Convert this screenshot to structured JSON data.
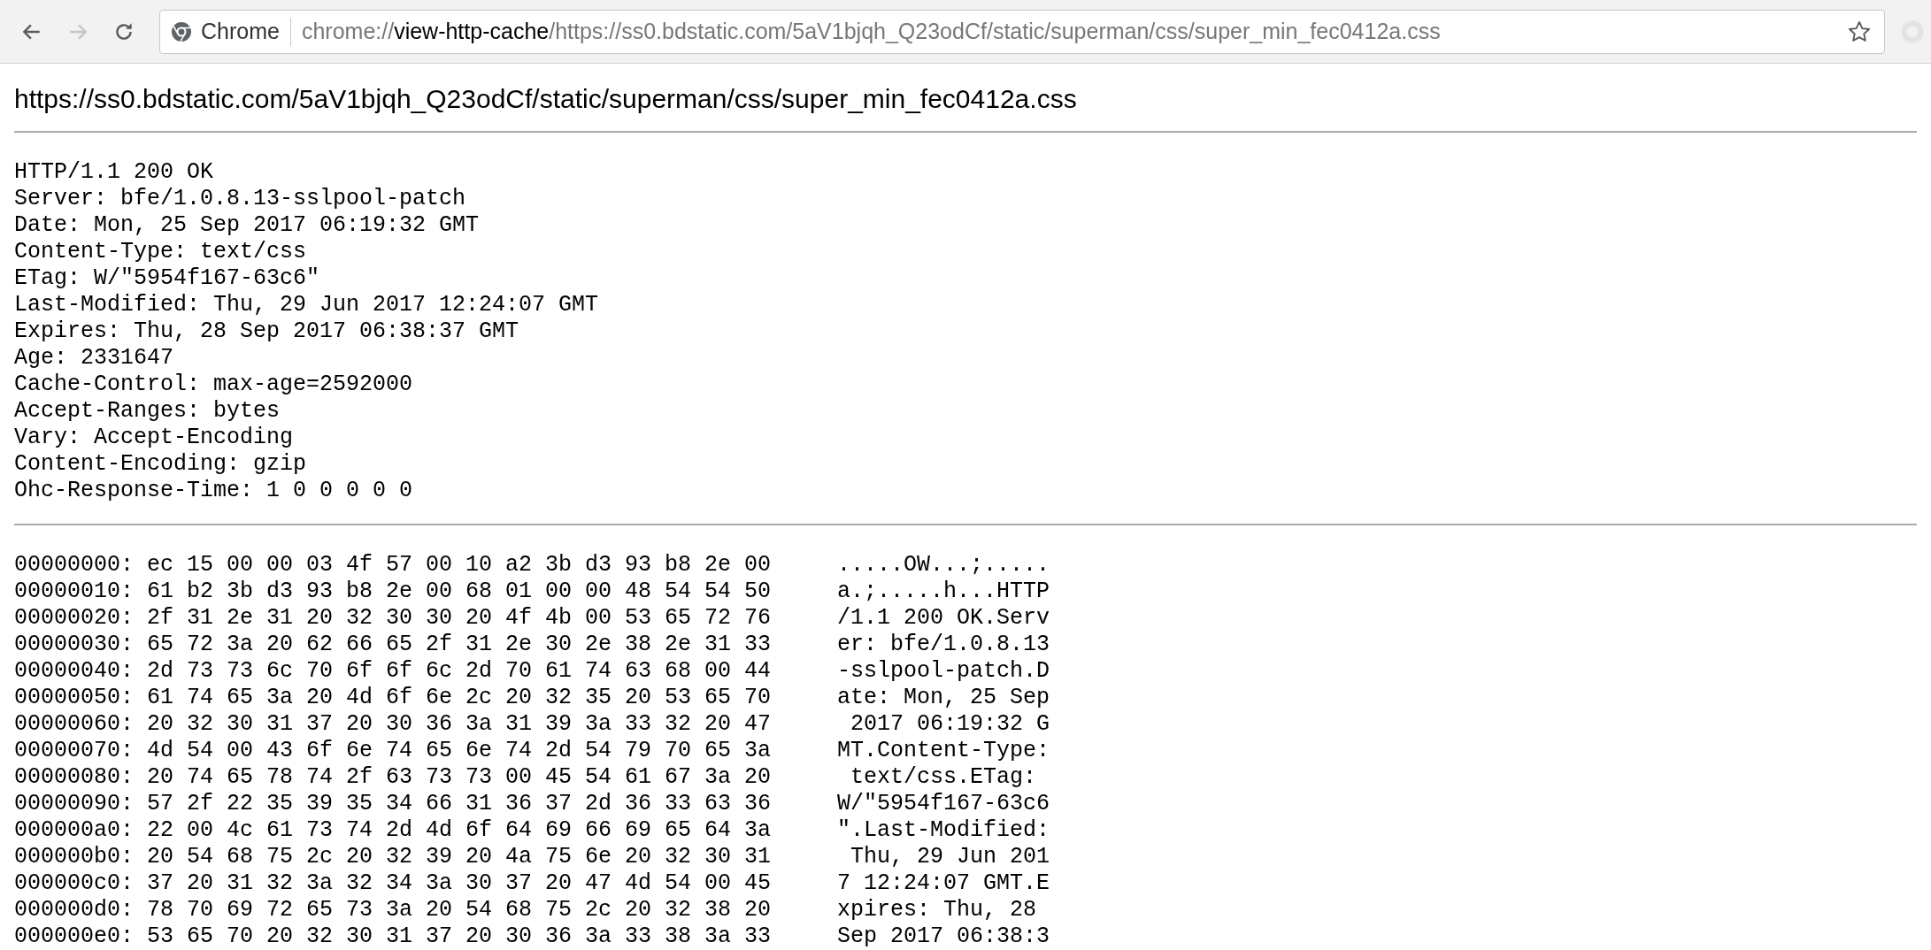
{
  "toolbar": {
    "back": {
      "disabled": false
    },
    "forward": {
      "disabled": true
    },
    "chip": "Chrome",
    "address": {
      "scheme": "chrome://",
      "host": "view-http-cache",
      "rest": "/https://ss0.bdstatic.com/5aV1bjqh_Q23odCf/static/superman/css/super_min_fec0412a.css"
    },
    "bookmarked": false
  },
  "page": {
    "heading": "https://ss0.bdstatic.com/5aV1bjqh_Q23odCf/static/superman/css/super_min_fec0412a.css",
    "headers": [
      "HTTP/1.1 200 OK",
      "Server: bfe/1.0.8.13-sslpool-patch",
      "Date: Mon, 25 Sep 2017 06:19:32 GMT",
      "Content-Type: text/css",
      "ETag: W/\"5954f167-63c6\"",
      "Last-Modified: Thu, 29 Jun 2017 12:24:07 GMT",
      "Expires: Thu, 28 Sep 2017 06:38:37 GMT",
      "Age: 2331647",
      "Cache-Control: max-age=2592000",
      "Accept-Ranges: bytes",
      "Vary: Accept-Encoding",
      "Content-Encoding: gzip",
      "Ohc-Response-Time: 1 0 0 0 0 0"
    ],
    "hex_rows": [
      {
        "offset": "00000000:",
        "hex": "ec 15 00 00 03 4f 57 00 10 a2 3b d3 93 b8 2e 00",
        "ascii": ".....OW...;....."
      },
      {
        "offset": "00000010:",
        "hex": "61 b2 3b d3 93 b8 2e 00 68 01 00 00 48 54 54 50",
        "ascii": "a.;.....h...HTTP"
      },
      {
        "offset": "00000020:",
        "hex": "2f 31 2e 31 20 32 30 30 20 4f 4b 00 53 65 72 76",
        "ascii": "/1.1 200 OK.Serv"
      },
      {
        "offset": "00000030:",
        "hex": "65 72 3a 20 62 66 65 2f 31 2e 30 2e 38 2e 31 33",
        "ascii": "er: bfe/1.0.8.13"
      },
      {
        "offset": "00000040:",
        "hex": "2d 73 73 6c 70 6f 6f 6c 2d 70 61 74 63 68 00 44",
        "ascii": "-sslpool-patch.D"
      },
      {
        "offset": "00000050:",
        "hex": "61 74 65 3a 20 4d 6f 6e 2c 20 32 35 20 53 65 70",
        "ascii": "ate: Mon, 25 Sep"
      },
      {
        "offset": "00000060:",
        "hex": "20 32 30 31 37 20 30 36 3a 31 39 3a 33 32 20 47",
        "ascii": " 2017 06:19:32 G"
      },
      {
        "offset": "00000070:",
        "hex": "4d 54 00 43 6f 6e 74 65 6e 74 2d 54 79 70 65 3a",
        "ascii": "MT.Content-Type:"
      },
      {
        "offset": "00000080:",
        "hex": "20 74 65 78 74 2f 63 73 73 00 45 54 61 67 3a 20",
        "ascii": " text/css.ETag: "
      },
      {
        "offset": "00000090:",
        "hex": "57 2f 22 35 39 35 34 66 31 36 37 2d 36 33 63 36",
        "ascii": "W/\"5954f167-63c6"
      },
      {
        "offset": "000000a0:",
        "hex": "22 00 4c 61 73 74 2d 4d 6f 64 69 66 69 65 64 3a",
        "ascii": "\".Last-Modified:"
      },
      {
        "offset": "000000b0:",
        "hex": "20 54 68 75 2c 20 32 39 20 4a 75 6e 20 32 30 31",
        "ascii": " Thu, 29 Jun 201"
      },
      {
        "offset": "000000c0:",
        "hex": "37 20 31 32 3a 32 34 3a 30 37 20 47 4d 54 00 45",
        "ascii": "7 12:24:07 GMT.E"
      },
      {
        "offset": "000000d0:",
        "hex": "78 70 69 72 65 73 3a 20 54 68 75 2c 20 32 38 20",
        "ascii": "xpires: Thu, 28 "
      },
      {
        "offset": "000000e0:",
        "hex": "53 65 70 20 32 30 31 37 20 30 36 3a 33 38 3a 33",
        "ascii": "Sep 2017 06:38:3"
      }
    ]
  }
}
